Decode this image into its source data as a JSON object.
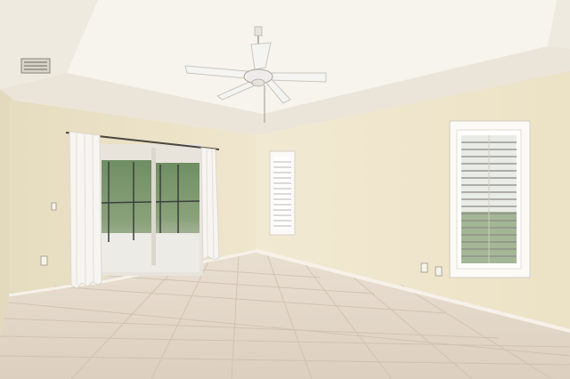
{
  "scene": {
    "subject": "empty-room-photo",
    "palette": {
      "wall_left": "#ece3c9",
      "wall_back": "#f0e8cf",
      "wall_right": "#efe6cc",
      "ceiling": "#f3efe6",
      "tray_ceiling": "#f7f4ee",
      "floor": "#e2d6c6",
      "grout": "#cdbfae",
      "trim": "#f6f2ea",
      "curtain": "#f7f5f1",
      "shutter": "#ffffff",
      "outdoor_green": "#5e7d55",
      "fan_body": "#f4f4f2"
    }
  }
}
